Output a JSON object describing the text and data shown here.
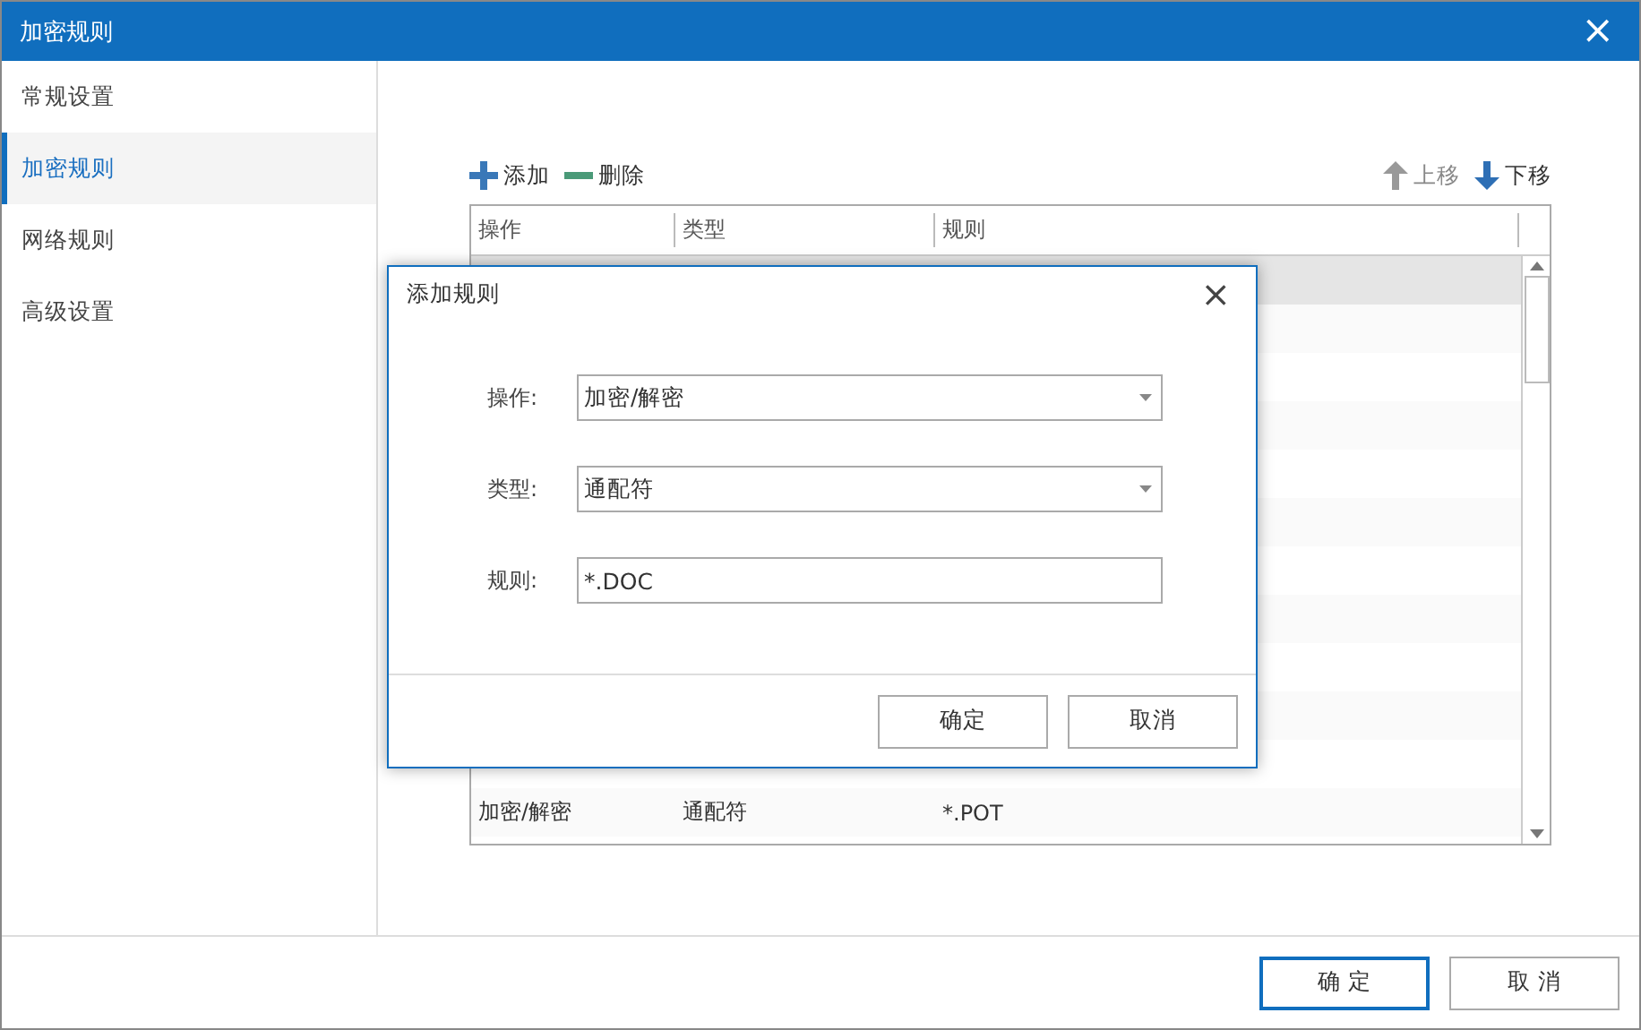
{
  "window": {
    "title": "加密规则",
    "close": "×"
  },
  "sidebar": {
    "items": [
      {
        "label": "常规设置",
        "selected": false
      },
      {
        "label": "加密规则",
        "selected": true
      },
      {
        "label": "网络规则",
        "selected": false
      },
      {
        "label": "高级设置",
        "selected": false
      }
    ]
  },
  "toolbar": {
    "left": [
      {
        "label": "添加",
        "kind": "add"
      },
      {
        "label": "删除",
        "kind": "remove"
      }
    ],
    "right": [
      {
        "label": "上移",
        "kind": "up",
        "disabled": true
      },
      {
        "label": "下移",
        "kind": "down",
        "disabled": false
      }
    ]
  },
  "table": {
    "columns": [
      "操作",
      "类型",
      "规则"
    ],
    "rows": [
      {
        "selected": true
      },
      {
        "selected": false
      },
      {
        "selected": false
      },
      {
        "selected": false
      },
      {
        "selected": false
      },
      {
        "selected": false
      },
      {
        "selected": false
      },
      {
        "selected": false
      },
      {
        "selected": false
      },
      {
        "selected": false
      },
      {
        "selected": false
      },
      {
        "selected": false,
        "cells": [
          "加密/解密",
          "通配符",
          "*.POT"
        ]
      }
    ]
  },
  "dialog": {
    "title": "添加规则",
    "close": "×",
    "fields": [
      {
        "label": "操作:",
        "value": "加密/解密",
        "kind": "select"
      },
      {
        "label": "类型:",
        "value": "通配符",
        "kind": "select"
      },
      {
        "label": "规则:",
        "value": "*.DOC",
        "kind": "text"
      }
    ],
    "buttons": [
      {
        "label": "确定"
      },
      {
        "label": "取消"
      }
    ]
  },
  "footer": {
    "buttons": [
      {
        "label": "确 定",
        "primary": true
      },
      {
        "label": "取 消",
        "primary": false
      }
    ]
  }
}
